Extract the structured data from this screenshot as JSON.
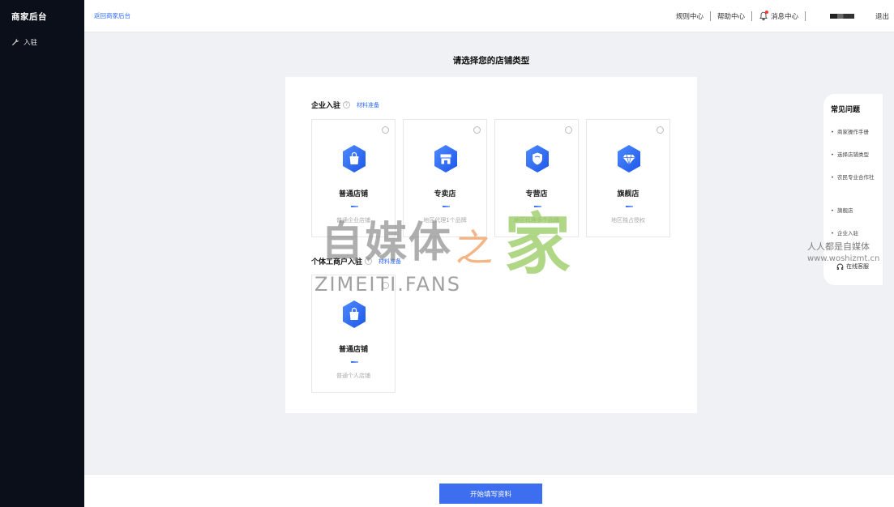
{
  "sidebar": {
    "brand": "商家后台",
    "items": [
      {
        "label": "入驻",
        "icon": "wrench-icon"
      }
    ]
  },
  "header": {
    "back_link": "返回商家后台",
    "links": {
      "rules": "规则中心",
      "help": "帮助中心",
      "messages": "消息中心"
    },
    "logout": "退出"
  },
  "page": {
    "title": "请选择您的店铺类型"
  },
  "enterprise": {
    "title": "企业入驻",
    "material_link": "材料准备",
    "cards": [
      {
        "name": "普通店铺",
        "desc": "普通企业店铺",
        "icon": "shopping-bag-icon"
      },
      {
        "name": "专卖店",
        "desc": "地区代理1个品牌",
        "icon": "storefront-icon"
      },
      {
        "name": "专营店",
        "desc": "地区代理多个品牌",
        "icon": "shield-icon"
      },
      {
        "name": "旗舰店",
        "desc": "地区独占授权",
        "icon": "diamond-icon"
      }
    ]
  },
  "individual": {
    "title": "个体工商户入驻",
    "material_link": "材料准备",
    "cards": [
      {
        "name": "普通店铺",
        "desc": "普通个人店铺",
        "icon": "shopping-bag-icon"
      }
    ]
  },
  "faq": {
    "title": "常见问题",
    "items": [
      "商家操作手册",
      "选择店铺类型",
      "农民专业合作社",
      "旗舰店",
      "企业入驻"
    ],
    "service": "在线客服"
  },
  "watermark": {
    "main": "自媒体",
    "zhi": "之",
    "jia": "家",
    "latin": "ZIMEITI.FANS",
    "site": "人人都是自媒体",
    "url": "www.woshizmt.cn"
  },
  "footer": {
    "start_button": "开始填写资料"
  },
  "colors": {
    "accent": "#3d6ef0",
    "sidebar_bg": "#0b0f1a",
    "link": "#2f6bff"
  }
}
